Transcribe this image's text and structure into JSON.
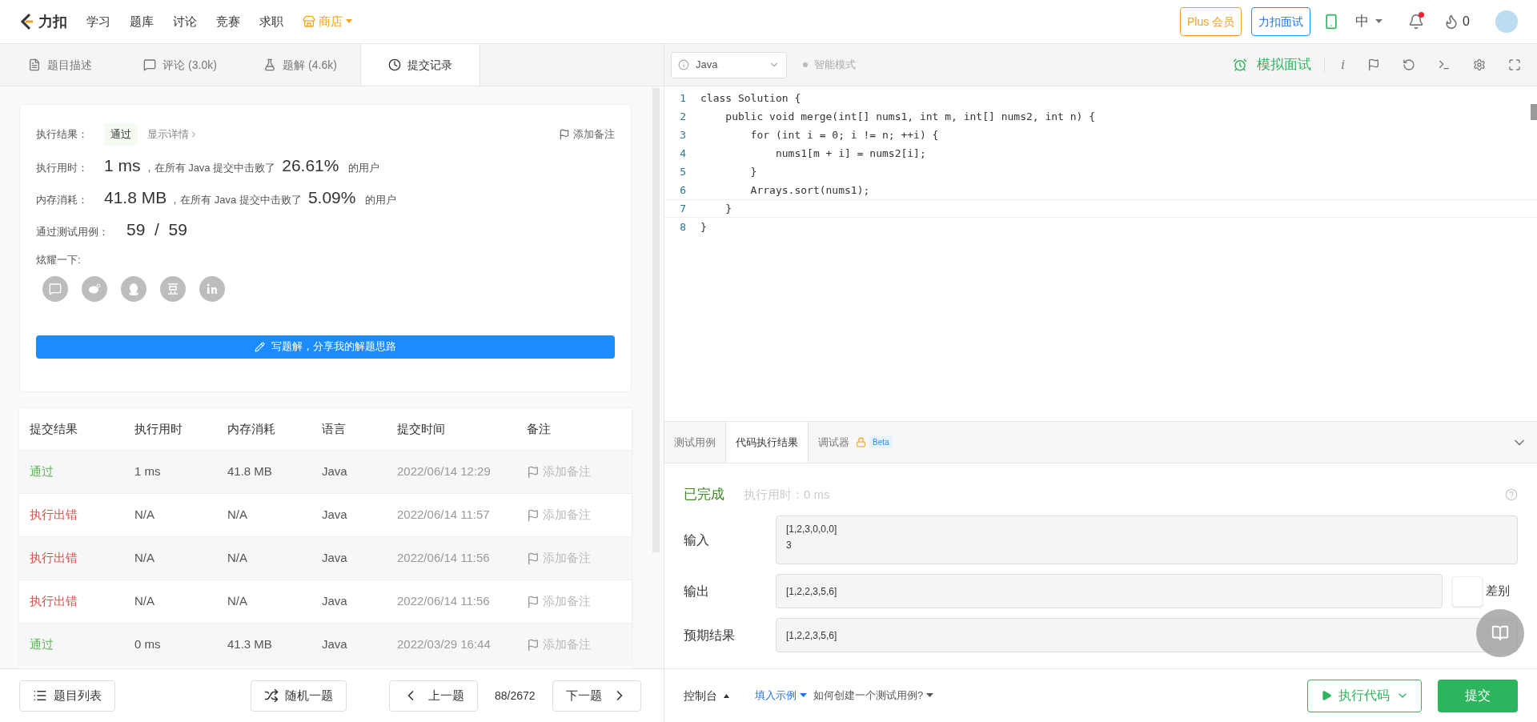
{
  "nav": {
    "logo": "力扣",
    "items": [
      "学习",
      "题库",
      "讨论",
      "竞赛",
      "求职"
    ],
    "store": "商店",
    "plus": "Plus 会员",
    "interview": "力扣面试",
    "lang": "中",
    "fire_count": "0",
    "notification": true
  },
  "left_tabs": [
    {
      "label": "题目描述",
      "selected": false
    },
    {
      "label": "评论 (3.0k)",
      "selected": false
    },
    {
      "label": "题解 (4.6k)",
      "selected": false
    },
    {
      "label": "提交记录",
      "selected": true
    }
  ],
  "result_card": {
    "result_label": "执行结果：",
    "result": "通过",
    "details": "显示详情",
    "add_note": "添加备注",
    "runtime_label": "执行用时：",
    "runtime": "1 ms",
    "runtime_text": "，在所有 Java 提交中击败了",
    "runtime_pct": "26.61%",
    "runtime_suffix": "的用户",
    "memory_label": "内存消耗：",
    "memory": "41.8 MB",
    "memory_text": "，在所有 Java 提交中击败了",
    "memory_pct": "5.09%",
    "memory_suffix": "的用户",
    "tests_label": "通过测试用例：",
    "tests": "59  /  59",
    "share_label": "炫耀一下:",
    "write_button": "写题解，分享我的解题思路"
  },
  "table": {
    "columns": [
      "提交结果",
      "执行用时",
      "内存消耗",
      "语言",
      "提交时间",
      "备注"
    ],
    "rows": [
      {
        "status": "通过",
        "kind": "pass",
        "time": "1 ms",
        "memory": "41.8 MB",
        "lang": "Java",
        "date": "2022/06/14 12:29",
        "note": "添加备注"
      },
      {
        "status": "执行出错",
        "kind": "error",
        "time": "N/A",
        "memory": "N/A",
        "lang": "Java",
        "date": "2022/06/14 11:57",
        "note": "添加备注"
      },
      {
        "status": "执行出错",
        "kind": "error",
        "time": "N/A",
        "memory": "N/A",
        "lang": "Java",
        "date": "2022/06/14 11:56",
        "note": "添加备注"
      },
      {
        "status": "执行出错",
        "kind": "error",
        "time": "N/A",
        "memory": "N/A",
        "lang": "Java",
        "date": "2022/06/14 11:56",
        "note": "添加备注"
      },
      {
        "status": "通过",
        "kind": "pass",
        "time": "0 ms",
        "memory": "41.3 MB",
        "lang": "Java",
        "date": "2022/03/29 16:44",
        "note": "添加备注"
      }
    ]
  },
  "left_footer": {
    "list": "题目列表",
    "random": "随机一题",
    "prev": "上一题",
    "counter": "88/2672",
    "next": "下一题"
  },
  "editor_toolbar": {
    "language": "Java",
    "smart_mode": "智能模式",
    "mock": "模拟面试",
    "info": "i"
  },
  "code": [
    {
      "number": "1",
      "text": "class Solution {"
    },
    {
      "number": "2",
      "text": "    public void merge(int[] nums1, int m, int[] nums2, int n) {"
    },
    {
      "number": "3",
      "text": "        for (int i = 0; i != n; ++i) {"
    },
    {
      "number": "4",
      "text": "            nums1[m + i] = nums2[i];"
    },
    {
      "number": "5",
      "text": "        }"
    },
    {
      "number": "6",
      "text": "        Arrays.sort(nums1);"
    },
    {
      "number": "7",
      "text": "    }"
    },
    {
      "number": "8",
      "text": "}"
    }
  ],
  "console_tabs": [
    {
      "label": "测试用例",
      "selected": false
    },
    {
      "label": "代码执行结果",
      "selected": true
    },
    {
      "label": "调试器",
      "selected": false,
      "badge": "Beta",
      "locked": true
    }
  ],
  "run_result": {
    "status": "已完成",
    "runtime": "执行用时：0 ms",
    "input_label": "输入",
    "input": [
      "[1,2,3,0,0,0]",
      "3"
    ],
    "output_label": "输出",
    "output": "[1,2,2,3,5,6]",
    "diff": "差别",
    "expected_label": "预期结果",
    "expected": "[1,2,2,3,5,6]"
  },
  "right_footer": {
    "console": "控制台",
    "fill_example": "填入示例",
    "how_to": "如何创建一个测试用例?",
    "run": "执行代码",
    "submit": "提交"
  }
}
